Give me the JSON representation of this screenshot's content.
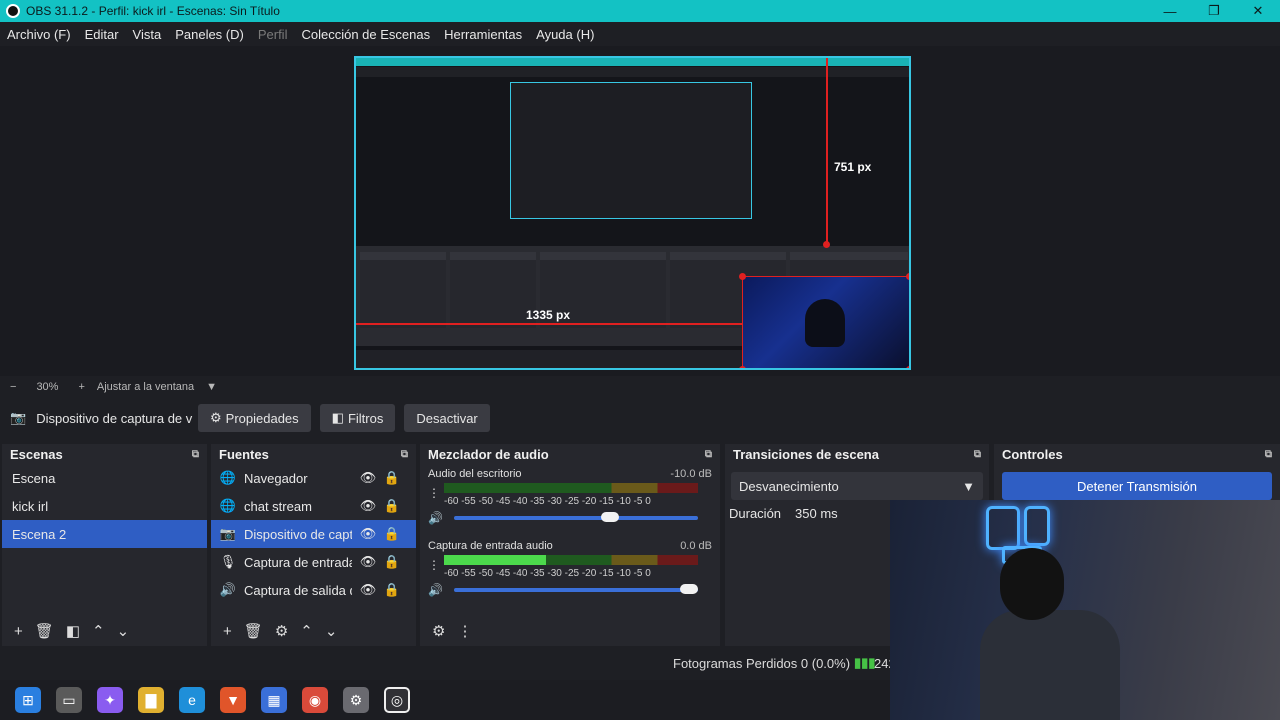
{
  "window": {
    "title": "OBS 31.1.2 - Perfil: kick irl - Escenas: Sin Título",
    "minimize": "—",
    "maximize": "❐",
    "close": "✕"
  },
  "menu": [
    {
      "label": "Archivo (F)",
      "enabled": true
    },
    {
      "label": "Editar",
      "enabled": true
    },
    {
      "label": "Vista",
      "enabled": true
    },
    {
      "label": "Paneles (D)",
      "enabled": true
    },
    {
      "label": "Perfil",
      "enabled": false
    },
    {
      "label": "Colección de Escenas",
      "enabled": true
    },
    {
      "label": "Herramientas",
      "enabled": true
    },
    {
      "label": "Ayuda (H)",
      "enabled": true
    }
  ],
  "preview": {
    "measure_vertical": "751 px",
    "measure_horizontal": "1335 px"
  },
  "zoom": {
    "minus": "−",
    "level": "30%",
    "plus": "+",
    "fit_label": "Ajustar a la ventana",
    "dropdown": "▼"
  },
  "source_toolbar": {
    "source_name": "Dispositivo de captura de v",
    "properties_label": "Propiedades",
    "filters_label": "Filtros",
    "deactivate_label": "Desactivar"
  },
  "scenes": {
    "title": "Escenas",
    "items": [
      "Escena",
      "kick irl",
      "Escena 2"
    ],
    "selected_index": 2
  },
  "sources": {
    "title": "Fuentes",
    "items": [
      {
        "label": "Navegador",
        "icon": "globe-icon"
      },
      {
        "label": "chat stream",
        "icon": "globe-icon"
      },
      {
        "label": "Dispositivo de capt",
        "icon": "camera-icon"
      },
      {
        "label": "Captura de entrada",
        "icon": "microphone-icon"
      },
      {
        "label": "Captura de salida d",
        "icon": "speaker-icon"
      }
    ],
    "selected_index": 2
  },
  "mixer": {
    "title": "Mezclador de audio",
    "channels": [
      {
        "name": "Audio del escritorio",
        "db": "-10.0 dB",
        "level": 0.0,
        "volume": 0.65
      },
      {
        "name": "Captura de entrada audio",
        "db": "0.0 dB",
        "level": 0.4,
        "volume": 1.0
      }
    ],
    "ticks": "-60 -55 -50 -45 -40 -35 -30 -25 -20 -15 -10 -5 0"
  },
  "transitions": {
    "title": "Transiciones de escena",
    "selected": "Desvanecimiento",
    "duration_label": "Duración",
    "duration_value": "350 ms"
  },
  "controls": {
    "title": "Controles",
    "stop_stream_label": "Detener Transmisión"
  },
  "status": {
    "dropped_frames": "Fotogramas Perdidos 0 (0.0%)",
    "bitrate_partial": "242"
  },
  "colors": {
    "accent_title": "#13c2c4",
    "selection": "#2f5ec4",
    "preview_border": "#38c7e3",
    "guide_red": "#e02020"
  }
}
